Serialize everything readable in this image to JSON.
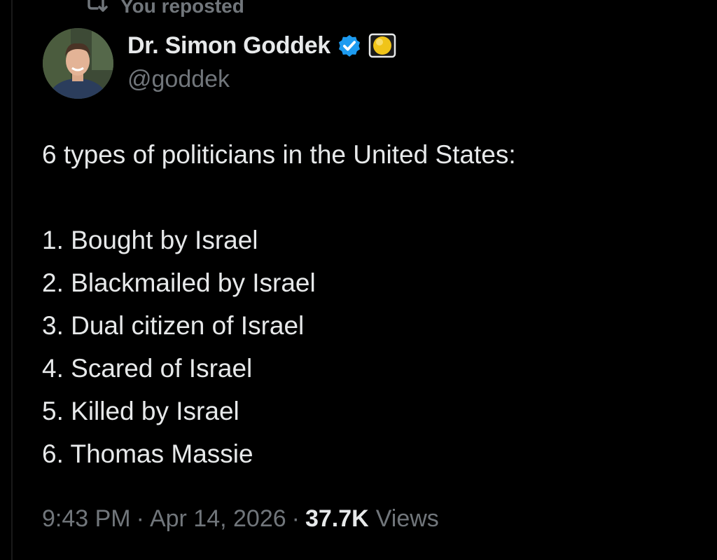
{
  "repost": {
    "icon": "repost-icon",
    "label": "You reposted"
  },
  "author": {
    "display_name": "Dr. Simon Goddek",
    "handle": "@goddek",
    "verified_icon": "verified-badge-icon",
    "affiliation_icon": "yellow-circle-icon",
    "colors": {
      "verified": "#1d9bf0",
      "affiliation": "#f0c419"
    }
  },
  "tweet": {
    "intro": "6 types of politicians in the United States:",
    "items": [
      "1. Bought by Israel",
      "2. Blackmailed by Israel",
      "3. Dual citizen of Israel",
      "4. Scared of Israel",
      "5. Killed by Israel",
      "6. Thomas Massie"
    ]
  },
  "meta": {
    "time": "9:43 PM",
    "date": "Apr 14, 2026",
    "separator": "·",
    "views_count": "37.7K",
    "views_label": "Views"
  },
  "theme": {
    "background": "#000000",
    "text": "#e7e9ea",
    "muted": "#71767b"
  }
}
